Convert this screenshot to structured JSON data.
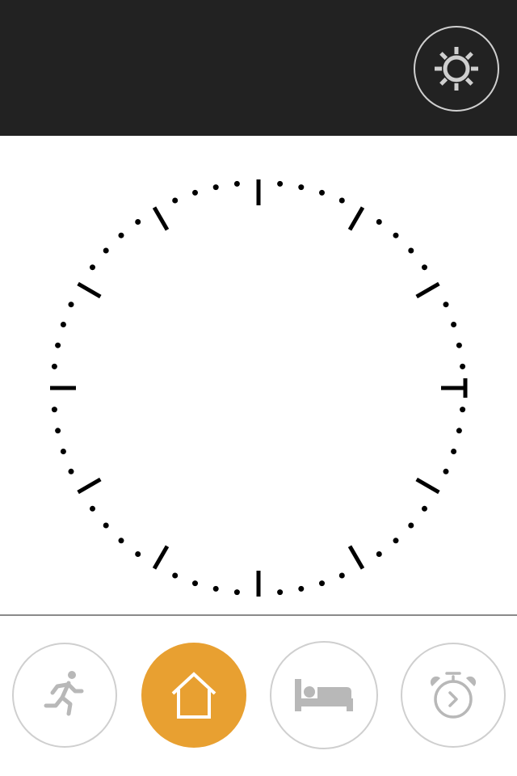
{
  "header": {
    "settings_icon": "gear-icon"
  },
  "clock": {
    "face": "analog-dial",
    "hour_marks": 12,
    "minute_marks": 60,
    "hands_visible": false
  },
  "modes": [
    {
      "id": "activity",
      "icon": "running-person-icon",
      "active": false
    },
    {
      "id": "home",
      "icon": "house-icon",
      "active": true
    },
    {
      "id": "sleep",
      "icon": "bed-icon",
      "active": false
    },
    {
      "id": "timer",
      "icon": "stopwatch-icon",
      "active": false
    }
  ],
  "colors": {
    "header_bg": "#222222",
    "accent": "#e8a031",
    "icon_inactive": "#b8b8b8",
    "icon_active": "#ffffff",
    "button_border": "#cfcfcf",
    "dial_marks": "#000000"
  }
}
